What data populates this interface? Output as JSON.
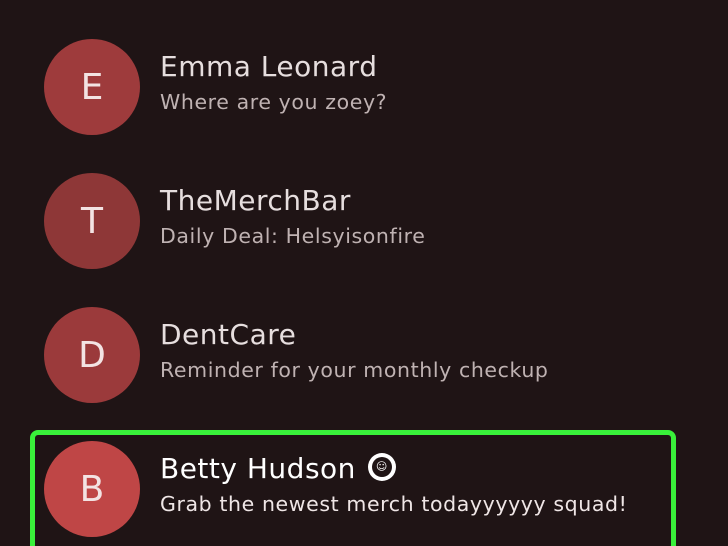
{
  "conversations": [
    {
      "initial": "E",
      "name": "Emma Leonard",
      "preview": "Where are you zoey?",
      "avatar_color": "#9e3b3c"
    },
    {
      "initial": "T",
      "name": "TheMerchBar",
      "preview": "Daily Deal: Helsyisonfire",
      "avatar_color": "#8e3737"
    },
    {
      "initial": "D",
      "name": "DentCare",
      "preview": "Reminder for your monthly checkup",
      "avatar_color": "#9b3a3b"
    },
    {
      "initial": "B",
      "name": "Betty Hudson",
      "preview": "Grab the newest merch todayyyyyy squad!",
      "avatar_color": "#bf4646",
      "unread_icon": "sticker-icon",
      "unread": true
    }
  ],
  "highlight_color": "#39f03a"
}
